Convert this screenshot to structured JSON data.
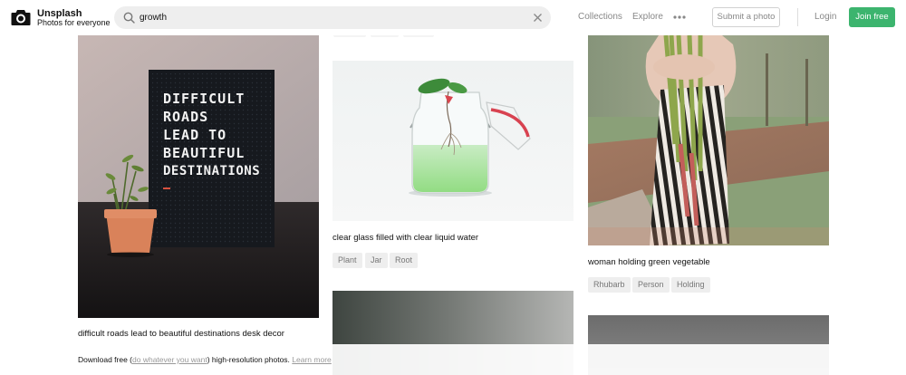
{
  "brand": {
    "name": "Unsplash",
    "tagline": "Photos for everyone"
  },
  "search": {
    "value": "growth"
  },
  "nav": {
    "collections": "Collections",
    "explore": "Explore"
  },
  "buttons": {
    "submit": "Submit a photo",
    "login": "Login",
    "join": "Join free"
  },
  "photos": [
    {
      "caption": "difficult roads lead to beautiful destinations desk decor",
      "board_lines": [
        "DIFFICULT",
        "ROADS",
        "LEAD TO",
        "BEAUTIFUL",
        "DESTINATIONS"
      ]
    },
    {
      "caption": "clear glass filled with clear liquid water",
      "tags": [
        "Plant",
        "Jar",
        "Root"
      ]
    },
    {
      "caption": "woman holding green vegetable",
      "tags": [
        "Rhubarb",
        "Person",
        "Holding"
      ]
    }
  ],
  "footer": {
    "prefix": "Download free (",
    "link1": "do whatever you want",
    "middle": ") high-resolution photos.",
    "link2": "Learn more"
  },
  "colors": {
    "join": "#3cb46e",
    "tag_bg": "#eeeeee"
  },
  "icons": [
    "camera-logo-icon",
    "search-icon",
    "close-icon",
    "more-icon"
  ]
}
